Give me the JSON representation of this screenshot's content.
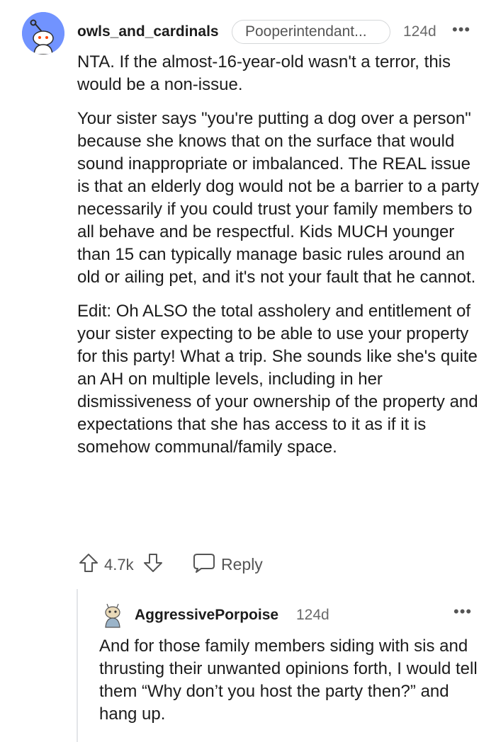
{
  "comment": {
    "username": "owls_and_cardinals",
    "flair": "Pooperintendant...",
    "age": "124d",
    "more": "•••",
    "paragraphs": [
      "NTA. If the almost-16-year-old wasn't a terror, this would be a non-issue.",
      "Your sister says \"you're putting a dog over a person\" because she knows that on the surface that would sound inappropriate or imbalanced. The REAL issue is that an elderly dog would not be a barrier to a party necessarily if you could trust your family members to all behave and be respectful. Kids MUCH younger than 15 can typically manage basic rules around an old or ailing pet, and it's not your fault that he cannot.",
      "Edit: Oh ALSO the total assholery and entitlement of your sister expecting to be able to use your property for this party! What a trip. She sounds like she's quite an AH on multiple levels, including in her dismissiveness of your ownership of the property and expectations that she has access to it as if it is somehow communal/family space."
    ],
    "vote_count": "4.7k",
    "reply_label": "Reply"
  },
  "reply": {
    "username": "AggressivePorpoise",
    "age": "124d",
    "more": "•••",
    "text": "And for those family members siding with sis and thrusting their unwanted opinions forth, I would tell them “Why don’t you host the party then?” and hang up."
  },
  "colors": {
    "avatar_bg": "#7193ff",
    "text": "#1c1c1c",
    "meta": "#6a6a6a"
  }
}
